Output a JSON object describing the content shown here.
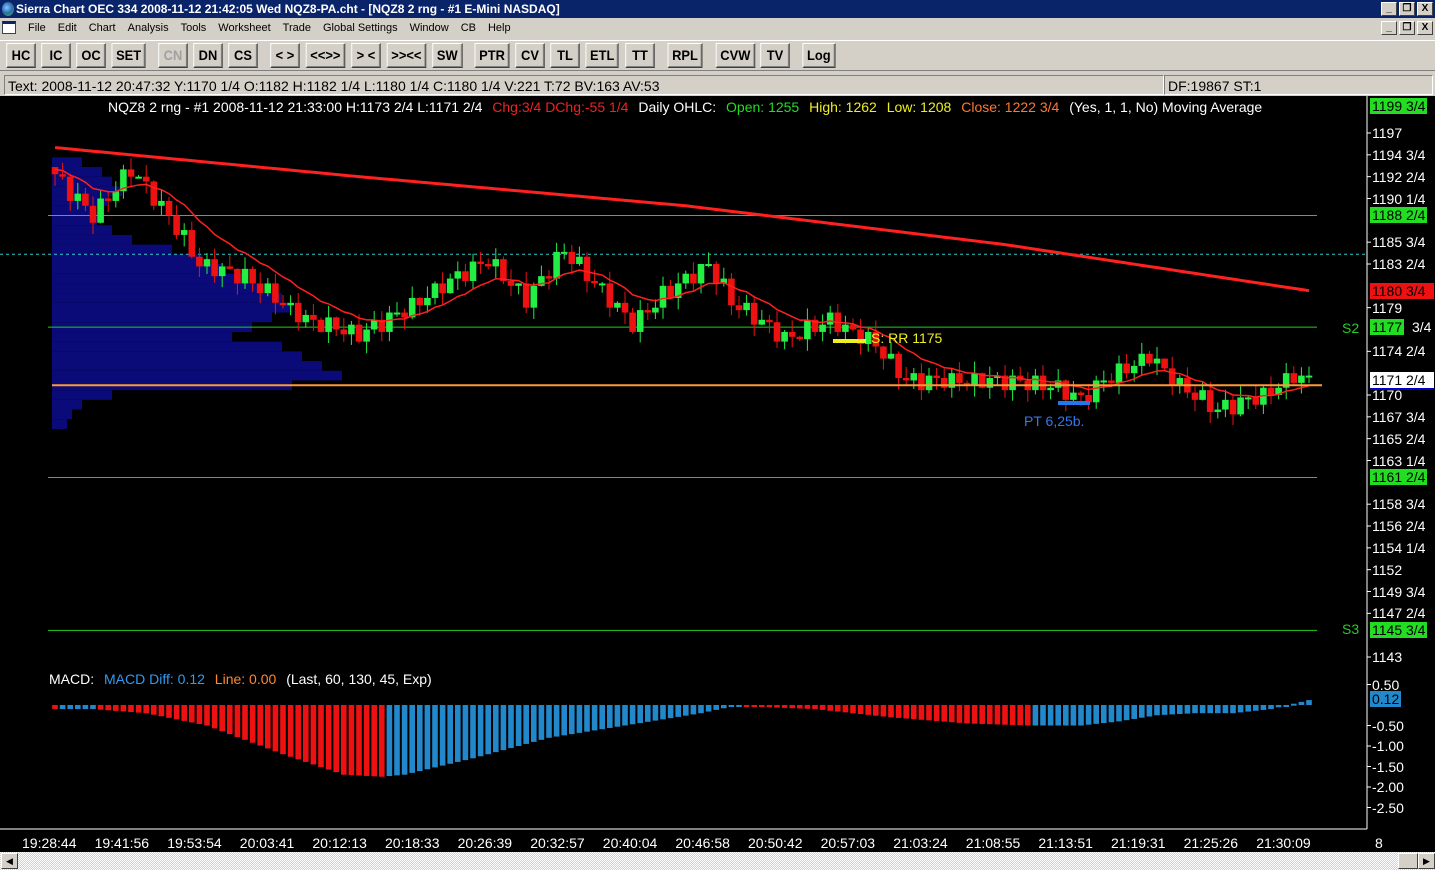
{
  "window": {
    "title": "Sierra Chart OEC 334  2008-11-12  21:42:05  Wed   NQZ8-PA.cht - [NQZ8  2 rng - #1 E-Mini NASDAQ]",
    "min": "_",
    "restore": "❐",
    "close": "X"
  },
  "menu": [
    "File",
    "Edit",
    "Chart",
    "Analysis",
    "Tools",
    "Worksheet",
    "Trade",
    "Global Settings",
    "Window",
    "CB",
    "Help"
  ],
  "toolbar": [
    [
      "HC",
      "IC",
      "OC",
      "SET"
    ],
    [
      "CN",
      "DN",
      "CS"
    ],
    [
      "< >",
      "<<>>",
      "> <",
      ">><<",
      "SW"
    ],
    [
      "PTR",
      "CV",
      "TL",
      "ETL",
      "TT"
    ],
    [
      "RPL"
    ],
    [
      "CVW",
      "TV"
    ],
    [
      "Log"
    ]
  ],
  "toolbar_disabled": [
    "CN"
  ],
  "info": {
    "text": "Text: 2008-11-12  20:47:32  Y:1170 1/4  O:1182  H:1182 1/4  L:1180 1/4  C:1180 1/4  V:221  T:72  BV:163  AV:53",
    "df": "DF:19867  ST:1"
  },
  "header": {
    "symbol": "NQZ8  2 rng - #1  2008-11-12  21:33:00  H:1173 2/4  L:1171 2/4",
    "chg": "Chg:3/4  DChg:-55 1/4",
    "daily": "Daily OHLC:",
    "open": "Open: 1255",
    "high": "High: 1262",
    "low": "Low: 1208",
    "close": "Close: 1222 3/4",
    "params": "(Yes, 1, 1, No)  Moving Average"
  },
  "macd_header": {
    "name": "MACD:",
    "diff": "MACD Diff: 0.12",
    "line": "Line: 0.00",
    "params": "(Last, 60, 130, 45, Exp)"
  },
  "annotations": {
    "rr": "S: RR 1175",
    "pt": "PT 6,25b.",
    "s2": "S2",
    "s3": "S3"
  },
  "colors": {
    "up": "#22ee44",
    "down": "#ee1111",
    "ma": "#ff2020",
    "level": "#22cc22",
    "orange": "#ff9933",
    "cyan": "#33cccc",
    "profile": "#0a0a78",
    "macd_blue": "#2288cc"
  },
  "chart_data": {
    "type": "candlestick",
    "bars": 166,
    "price_range": [
      1143,
      1197
    ],
    "close_keypoints": [
      [
        0,
        1192.75
      ],
      [
        2,
        1191
      ],
      [
        5,
        1188.5
      ],
      [
        10,
        1193.25
      ],
      [
        15,
        1188.5
      ],
      [
        19,
        1183.5
      ],
      [
        25,
        1182.25
      ],
      [
        33,
        1177.75
      ],
      [
        40,
        1176.25
      ],
      [
        46,
        1178.75
      ],
      [
        51,
        1181.25
      ],
      [
        57,
        1184
      ],
      [
        62,
        1179.75
      ],
      [
        67,
        1185
      ],
      [
        72,
        1180.75
      ],
      [
        76,
        1177.25
      ],
      [
        80,
        1180.25
      ],
      [
        86,
        1183.5
      ],
      [
        89,
        1179.75
      ],
      [
        96,
        1175.75
      ],
      [
        102,
        1177.75
      ],
      [
        108,
        1175.25
      ],
      [
        112,
        1171.5
      ],
      [
        119,
        1171.5
      ],
      [
        125,
        1171.5
      ],
      [
        131,
        1171
      ],
      [
        135,
        1169.5
      ],
      [
        138,
        1171.5
      ],
      [
        144,
        1174
      ],
      [
        148,
        1171
      ],
      [
        153,
        1168.5
      ],
      [
        159,
        1170
      ],
      [
        163,
        1172
      ],
      [
        165,
        1171.5
      ]
    ],
    "slow_ma": [
      [
        0,
        1195.5
      ],
      [
        40,
        1192.5
      ],
      [
        83,
        1189.5
      ],
      [
        125,
        1185.5
      ],
      [
        165,
        1180.75
      ]
    ],
    "levels": [
      {
        "price": 1188.5,
        "label": "1188 2/4"
      },
      {
        "price": 1177,
        "label": "1177",
        "name": "S2"
      },
      {
        "price": 1161.5,
        "label": "1161 2/4"
      },
      {
        "price": 1145.75,
        "label": "1145 3/4",
        "name": "S3"
      }
    ],
    "orange_level": 1171,
    "cyan_level": 1184.5,
    "volume_profile": [
      [
        1194,
        30
      ],
      [
        1193,
        50
      ],
      [
        1192,
        60
      ],
      [
        1191,
        70
      ],
      [
        1190,
        55
      ],
      [
        1189,
        40
      ],
      [
        1188,
        45
      ],
      [
        1187,
        60
      ],
      [
        1186,
        80
      ],
      [
        1185,
        120
      ],
      [
        1184,
        150
      ],
      [
        1183,
        170
      ],
      [
        1182,
        190
      ],
      [
        1181,
        210
      ],
      [
        1180,
        230
      ],
      [
        1179,
        240
      ],
      [
        1178,
        220
      ],
      [
        1177,
        200
      ],
      [
        1176,
        180
      ],
      [
        1175,
        230
      ],
      [
        1174,
        250
      ],
      [
        1173,
        270
      ],
      [
        1172,
        290
      ],
      [
        1171,
        240
      ],
      [
        1170,
        60
      ],
      [
        1169,
        30
      ],
      [
        1168,
        20
      ],
      [
        1167,
        15
      ]
    ],
    "price_ticks": [
      "1197",
      "1194 3/4",
      "1192 2/4",
      "1190 1/4",
      "1185 3/4",
      "1183 2/4",
      "1179",
      "1174 2/4",
      "1170",
      "1167 3/4",
      "1165 2/4",
      "1163 1/4",
      "1158 3/4",
      "1156 2/4",
      "1154 1/4",
      "1152",
      "1149 3/4",
      "1147 2/4",
      "1143"
    ],
    "price_tick_values": [
      1197,
      1194.75,
      1192.5,
      1190.25,
      1185.75,
      1183.5,
      1179,
      1174.5,
      1170,
      1167.75,
      1165.5,
      1163.25,
      1158.75,
      1156.5,
      1154.25,
      1152,
      1149.75,
      1147.5,
      1143
    ],
    "highlight_labels": {
      "top": "1199 3/4",
      "ma": "1180 3/4",
      "last": "1171 2/4",
      "s2_suffix": "3/4"
    },
    "macd_keypoints": [
      [
        0,
        -0.1
      ],
      [
        5,
        -0.1
      ],
      [
        12,
        -0.2
      ],
      [
        20,
        -0.5
      ],
      [
        30,
        -1.2
      ],
      [
        38,
        -1.7
      ],
      [
        43,
        -1.75
      ],
      [
        46,
        -1.7
      ],
      [
        55,
        -1.3
      ],
      [
        65,
        -0.8
      ],
      [
        75,
        -0.5
      ],
      [
        85,
        -0.2
      ],
      [
        90,
        0
      ],
      [
        93,
        -0.05
      ],
      [
        100,
        -0.1
      ],
      [
        110,
        -0.3
      ],
      [
        120,
        -0.45
      ],
      [
        128,
        -0.5
      ],
      [
        135,
        -0.5
      ],
      [
        140,
        -0.4
      ],
      [
        145,
        -0.25
      ],
      [
        150,
        -0.2
      ],
      [
        155,
        -0.2
      ],
      [
        160,
        -0.1
      ],
      [
        165,
        0.12
      ]
    ],
    "macd_ticks": [
      "0.50",
      "-0.50",
      "-1.00",
      "-1.50",
      "-2.00",
      "-2.50"
    ],
    "macd_tick_values": [
      0.5,
      -0.5,
      -1,
      -1.5,
      -2,
      -2.5
    ],
    "macd_last": "0.12",
    "time_labels": [
      "19:28:44",
      "19:41:56",
      "19:53:54",
      "20:03:41",
      "20:12:13",
      "20:18:33",
      "20:26:39",
      "20:32:57",
      "20:40:04",
      "20:46:58",
      "20:50:42",
      "20:57:03",
      "21:03:24",
      "21:08:55",
      "21:13:51",
      "21:19:31",
      "21:25:26",
      "21:30:09"
    ],
    "axis_corner": "8"
  }
}
